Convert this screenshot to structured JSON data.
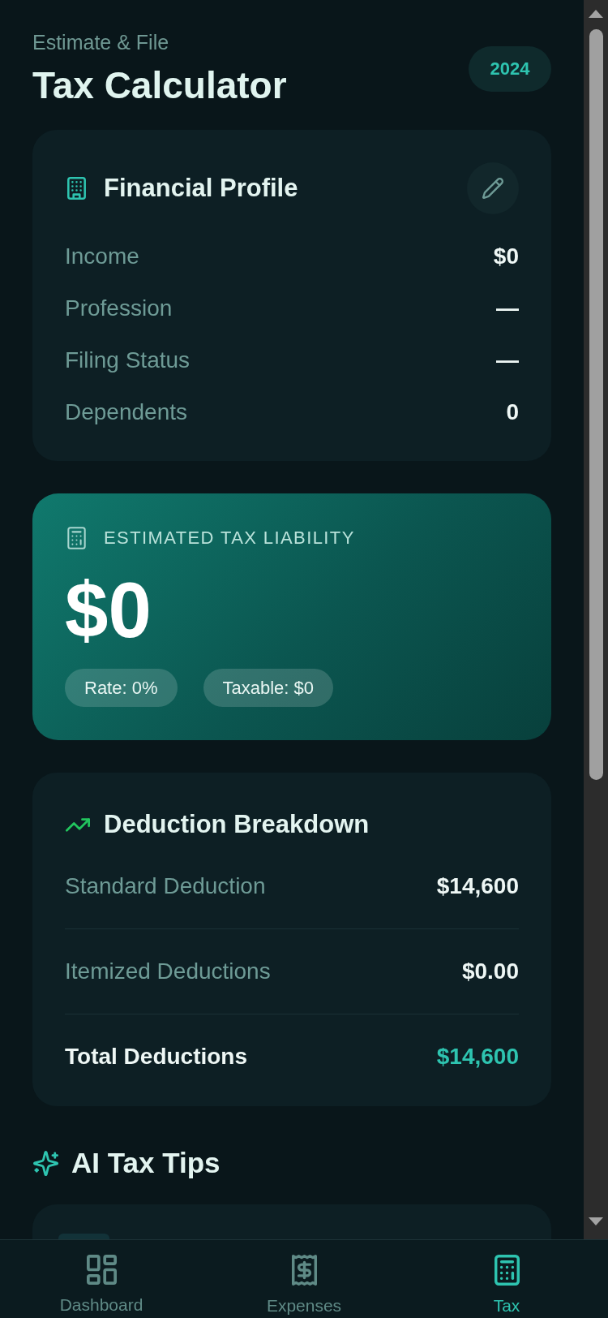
{
  "header": {
    "subtitle": "Estimate & File",
    "title": "Tax Calculator",
    "year_badge": "2024"
  },
  "financial_profile": {
    "title": "Financial Profile",
    "rows": [
      {
        "label": "Income",
        "value": "$0"
      },
      {
        "label": "Profession",
        "value": "—"
      },
      {
        "label": "Filing Status",
        "value": "—"
      },
      {
        "label": "Dependents",
        "value": "0"
      }
    ]
  },
  "tax_liability": {
    "label": "ESTIMATED TAX LIABILITY",
    "amount": "$0",
    "chips": [
      "Rate: 0%",
      "Taxable: $0"
    ]
  },
  "deductions": {
    "title": "Deduction Breakdown",
    "rows": [
      {
        "kind": "item",
        "label": "Standard Deduction",
        "value": "$14,600"
      },
      {
        "kind": "item",
        "label": "Itemized Deductions",
        "value": "$0.00"
      },
      {
        "kind": "total",
        "label": "Total Deductions",
        "value": "$14,600"
      }
    ]
  },
  "ai_tips": {
    "title": "AI Tax Tips"
  },
  "bottom_nav": [
    {
      "label": "Dashboard",
      "selected": false
    },
    {
      "label": "Expenses",
      "selected": false
    },
    {
      "label": "Tax",
      "selected": true
    }
  ]
}
